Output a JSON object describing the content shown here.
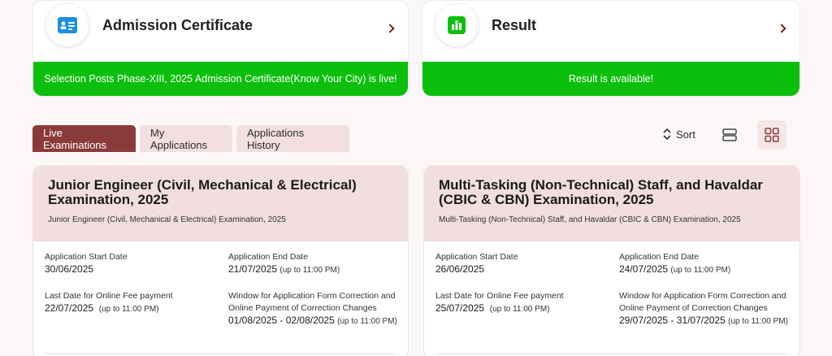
{
  "cards": {
    "admit": {
      "title": "Admission Certificate",
      "banner": "Selection Posts Phase-XIII, 2025 Admission Certificate(Know Your City) is live!",
      "icon": "id-card-icon"
    },
    "result": {
      "title": "Result",
      "banner": "Result is available!",
      "icon": "bar-chart-icon"
    }
  },
  "tabs": [
    {
      "label": "Live Examinations",
      "active": true
    },
    {
      "label": "My Applications",
      "active": false
    },
    {
      "label": "Applications History",
      "active": false
    }
  ],
  "toolbar": {
    "sort_label": "Sort"
  },
  "colors": {
    "accent": "#8b3a3a",
    "banner_green": "#0cbf0c",
    "card_head": "#f2dede"
  },
  "exams": [
    {
      "title": "Junior Engineer (Civil, Mechanical & Electrical) Examination, 2025",
      "subtitle": "Junior Engineer (Civil, Mechanical & Electrical) Examination, 2025",
      "fields": {
        "start_label": "Application Start Date",
        "start_value": "30/06/2025",
        "end_label": "Application End Date",
        "end_value": "21/07/2025",
        "end_note": "(up to 11:00 PM)",
        "fee_label": "Last Date for Online Fee payment",
        "fee_value": "22/07/2025",
        "fee_note": "(up to 11:00 PM)",
        "corr_label_1": "Window for Application Form Correction and",
        "corr_label_2": "Online Payment of Correction Changes",
        "corr_value": "01/08/2025 - 02/08/2025",
        "corr_note": "(up to 11:00 PM)"
      }
    },
    {
      "title": "Multi-Tasking (Non-Technical) Staff, and Havaldar (CBIC & CBN) Examination, 2025",
      "subtitle": "Multi-Tasking (Non-Technical) Staff, and Havaldar (CBIC & CBN) Examination, 2025",
      "fields": {
        "start_label": "Application Start Date",
        "start_value": "26/06/2025",
        "end_label": "Application End Date",
        "end_value": "24/07/2025",
        "end_note": "(up to 11:00 PM)",
        "fee_label": "Last Date for Online Fee payment",
        "fee_value": "25/07/2025",
        "fee_note": "(up to 11:00 PM)",
        "corr_label_1": "Window for Application Form Correction and",
        "corr_label_2": "Online Payment of Correction Changes",
        "corr_value": "29/07/2025 - 31/07/2025",
        "corr_note": "(up to 11:00 PM)"
      }
    }
  ]
}
